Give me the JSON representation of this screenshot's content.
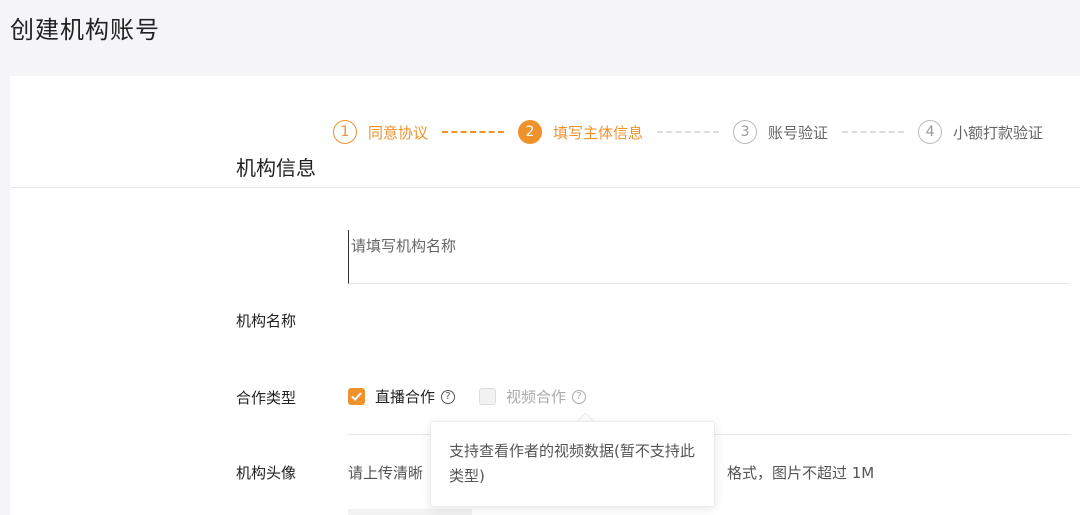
{
  "page": {
    "title": "创建机构账号"
  },
  "steps": [
    {
      "num": "1",
      "label": "同意协议",
      "state": "done"
    },
    {
      "num": "2",
      "label": "填写主体信息",
      "state": "active"
    },
    {
      "num": "3",
      "label": "账号验证",
      "state": "pending"
    },
    {
      "num": "4",
      "label": "小额打款验证",
      "state": "pending"
    }
  ],
  "form": {
    "section_title": "机构信息",
    "name": {
      "label": "机构名称",
      "placeholder": "请填写机构名称",
      "value": ""
    },
    "coop": {
      "label": "合作类型",
      "options": [
        {
          "label": "直播合作",
          "checked": true,
          "disabled": false
        },
        {
          "label": "视频合作",
          "checked": false,
          "disabled": true
        }
      ],
      "help_glyph": "?"
    },
    "avatar": {
      "label": "机构头像",
      "hint_start": "请上传清晰",
      "hint_end": "格式，图片不超过 1M"
    }
  },
  "tooltip": {
    "text": "支持查看作者的视频数据(暂不支持此类型)"
  },
  "colors": {
    "accent": "#f0922c",
    "background": "#f5f5f7"
  }
}
